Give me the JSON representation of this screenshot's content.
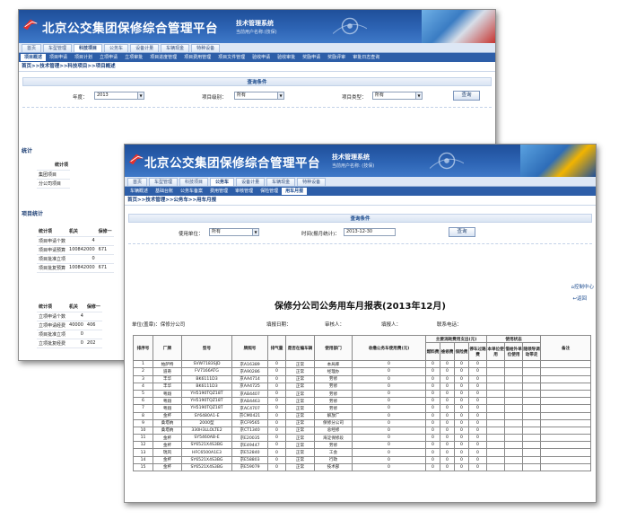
{
  "brand": {
    "title": "北京公交集团保修综合管理平台",
    "subtitle": "技术管理系统",
    "current_user": "当前用户名称:(技保)",
    "current_user2": "当前用户名称: (技保)"
  },
  "w1": {
    "tabs": [
      "首页",
      "车型管理",
      "科技项目",
      "公务车",
      "设备计量",
      "车辆现金",
      "特种设备"
    ],
    "active_tab": 2,
    "subnav": [
      "项目概述",
      "项目申请",
      "项目计划",
      "立项申请",
      "立项审批",
      "项目进度管理",
      "项目费用管理",
      "项目文件管理",
      "验收申请",
      "验收审批",
      "奖励申请",
      "奖励评审",
      "审批日志查询"
    ],
    "active_sub": 0,
    "breadcrumb": "首页>>技术管理>>科技项目>>项目概述",
    "query_title": "查询条件",
    "year_label": "年度：",
    "year_value": "2013",
    "level_label": "项目级别：",
    "level_value": "所有",
    "type_label": "项目类型：",
    "type_value": "所有",
    "query_btn": "查询",
    "stats_title": "统计",
    "stats_head": "统计项",
    "stats_rows": [
      "集团项目",
      "分公司项目"
    ],
    "proj_title": "项目统计",
    "proj_head": [
      "统计项",
      "机关",
      "保修一"
    ],
    "proj_rows": [
      [
        "项目申请个数",
        "4",
        ""
      ],
      [
        "项目申请预算",
        "100842000",
        "671"
      ],
      [
        "项目批准立项",
        "0",
        ""
      ],
      [
        "项目批复预算",
        "100842000",
        "671"
      ]
    ],
    "proj2_head": [
      "统计项",
      "机关",
      "保修一"
    ],
    "proj2_rows": [
      [
        "立项申请个数",
        "4",
        ""
      ],
      [
        "立项申请经费",
        "40000",
        "406"
      ],
      [
        "项目批准立项",
        "0",
        ""
      ],
      [
        "立项批复经费",
        "0",
        "202"
      ]
    ]
  },
  "w2": {
    "tabs": [
      "首页",
      "车型管理",
      "科技项目",
      "公务车",
      "设备计量",
      "车辆现金",
      "特种设备"
    ],
    "active_tab": 3,
    "subnav": [
      "车辆概述",
      "基础台账",
      "公务车备案",
      "费用管理",
      "审核管理",
      "保险管理",
      "用车月报"
    ],
    "active_sub": 6,
    "breadcrumb": "首页>>技术管理>>公务车>>用车月报",
    "query_title": "查询条件",
    "unit_label": "使用单位：",
    "unit_value": "所有",
    "time_label": "时间(报月统计)：",
    "time_value": "2013-12-30",
    "query_btn": "查询",
    "ctl_center": "控制中心",
    "ctl_back": "返回",
    "report_title": "保修分公司公务用车月报表(2013年12月)",
    "fill_unit_label": "单位(盖章)：",
    "fill_unit": "保修分公司",
    "fill_date_label": "填报日期：",
    "reviewer_label": "审核人：",
    "filler_label": "填报人：",
    "phone_label": "联系电话：",
    "col_headers": [
      "排序号",
      "厂牌",
      "型号",
      "牌照号",
      "排气量",
      "是否在编车辆",
      "使用部门",
      "收缴公务车使用费(元)",
      "主要消耗费用支出(元)",
      "燃料费",
      "维修费",
      "保险费",
      "停车过路费",
      "使用状态",
      "本单位使用",
      "借给外单位使用",
      "随领导调动带走",
      "备注"
    ],
    "rows": [
      [
        "1",
        "帕萨特",
        "SVW7183SJD",
        "京A16389",
        "0",
        "正常",
        "本局库",
        "0",
        "0",
        "0",
        "0",
        "0"
      ],
      [
        "2",
        "道奇",
        "FV7166ATG",
        "京A90286",
        "0",
        "正常",
        "经理办",
        "0",
        "0",
        "0",
        "0",
        "0"
      ],
      [
        "3",
        "丰华",
        "BK6111D3",
        "京AA4714",
        "0",
        "正常",
        "劳修",
        "0",
        "0",
        "0",
        "0",
        "0"
      ],
      [
        "4",
        "丰华",
        "BK6111D3",
        "京AA4725",
        "0",
        "正常",
        "劳修",
        "0",
        "0",
        "0",
        "0",
        "0"
      ],
      [
        "5",
        "粤翔",
        "YH5190TQZ18T",
        "京AB4407",
        "0",
        "正常",
        "劳修",
        "0",
        "0",
        "0",
        "0",
        "0"
      ],
      [
        "6",
        "粤翔",
        "YH5190TQZ18T",
        "京AB4463",
        "0",
        "正常",
        "劳修",
        "0",
        "0",
        "0",
        "0",
        "0"
      ],
      [
        "7",
        "粤翔",
        "YH5190TQZ18T",
        "京AC4707",
        "0",
        "正常",
        "劳修",
        "0",
        "0",
        "0",
        "0",
        "0"
      ],
      [
        "8",
        "金杯",
        "SY6480A1-E",
        "京CM0421",
        "0",
        "正常",
        "解放厂",
        "0",
        "0",
        "0",
        "0",
        "0"
      ],
      [
        "9",
        "桑塔纳",
        "2000型",
        "京CF9565",
        "0",
        "正常",
        "保修分公司",
        "0",
        "0",
        "0",
        "0",
        "0"
      ],
      [
        "10",
        "桑塔纳",
        "330H3LLOLTE2",
        "京CT1340",
        "0",
        "正常",
        "总经修",
        "0",
        "0",
        "0",
        "0",
        "0"
      ],
      [
        "11",
        "金杯",
        "SY5460AB-E",
        "京E20035",
        "0",
        "正常",
        "海淀保修段",
        "0",
        "0",
        "0",
        "0",
        "0"
      ],
      [
        "12",
        "金杯",
        "SY6521X4S3BG",
        "京E49447",
        "0",
        "正常",
        "劳修",
        "0",
        "0",
        "0",
        "0",
        "0"
      ],
      [
        "13",
        "瑞风",
        "HFC6500A1E3",
        "京E52840",
        "0",
        "正常",
        "工会",
        "0",
        "0",
        "0",
        "0",
        "0"
      ],
      [
        "14",
        "金杯",
        "SY6521X4S3BG",
        "京E58803",
        "0",
        "正常",
        "行政",
        "0",
        "0",
        "0",
        "0",
        "0"
      ],
      [
        "15",
        "金杯",
        "SY6521X4S3BG",
        "京E59079",
        "0",
        "正常",
        "技术部",
        "0",
        "0",
        "0",
        "0",
        "0"
      ]
    ]
  },
  "colors": {
    "header_blue": "#2d64b4",
    "nav_blue": "#2d5ea8",
    "tab_bg": "#dde7f5"
  }
}
